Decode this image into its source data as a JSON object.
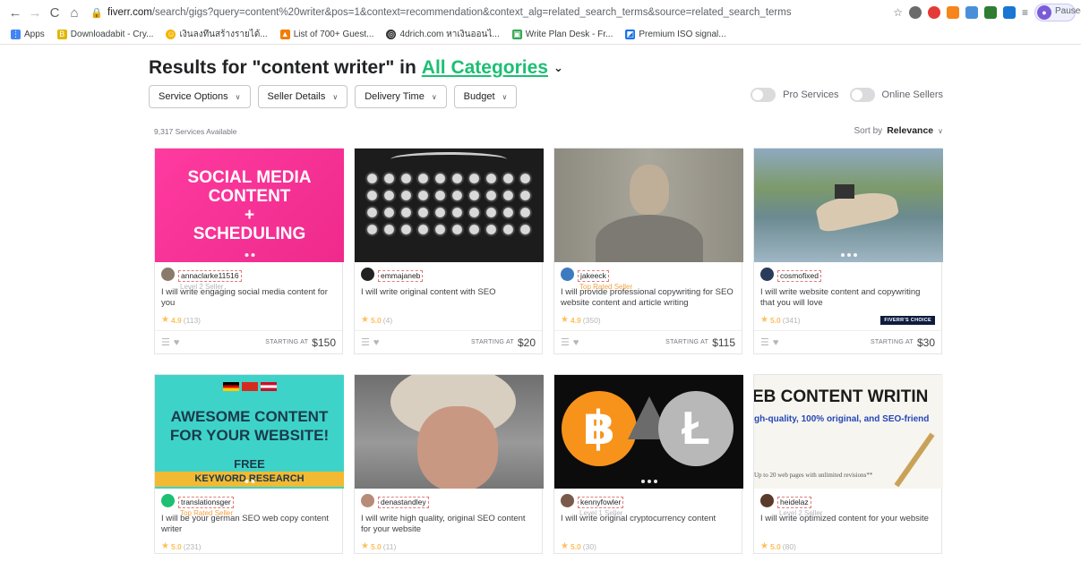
{
  "browser": {
    "url_host": "fiverr.com",
    "url_path": "/search/gigs?query=content%20writer&pos=1&context=recommendation&context_alg=related_search_terms&source=related_search_terms",
    "profile_status": "Paused",
    "bookmarks": [
      {
        "label": "Apps",
        "color": "#4285f4"
      },
      {
        "label": "Downloadabit - Cry...",
        "color": "#e0b700"
      },
      {
        "label": "เงินลงทึนสร้างรายได้...",
        "color": "#f4b400"
      },
      {
        "label": "List of 700+ Guest...",
        "color": "#f57c00"
      },
      {
        "label": "4drich.com หาเงินออนไ...",
        "color": "#333333"
      },
      {
        "label": "Write Plan Desk - Fr...",
        "color": "#34a853"
      },
      {
        "label": "Premium ISO signal...",
        "color": "#1a73e8"
      }
    ]
  },
  "header": {
    "title_prefix": "Results for \"content writer\" in",
    "category": "All Categories"
  },
  "filters": [
    "Service Options",
    "Seller Details",
    "Delivery Time",
    "Budget"
  ],
  "toggles": [
    "Pro Services",
    "Online Sellers"
  ],
  "results_count": "9,317 Services Available",
  "sort": {
    "label": "Sort by",
    "value": "Relevance"
  },
  "cards": [
    {
      "seller": "annaclarke11516",
      "level": "Level 2 Seller",
      "title": "I will write engaging social media content for you",
      "score": "4.9",
      "reviews": "(113)",
      "price": "$150",
      "badge": "",
      "start_label": "STARTING AT",
      "thumb_lines": [
        "SOCIAL MEDIA",
        "CONTENT",
        "+",
        "SCHEDULING"
      ]
    },
    {
      "seller": "emmajaneb",
      "level": "",
      "title": "I will write original content with SEO",
      "score": "5.0",
      "reviews": "(4)",
      "price": "$20",
      "badge": "",
      "start_label": "STARTING AT"
    },
    {
      "seller": "jakeeck",
      "level": "Top Rated Seller",
      "title": "I will provide professional copywriting for SEO website content and article writing",
      "score": "4.9",
      "reviews": "(350)",
      "price": "$115",
      "badge": "",
      "start_label": "STARTING AT"
    },
    {
      "seller": "cosmofixed",
      "level": "",
      "title": "I will write website content and copywriting that you will love",
      "score": "5.0",
      "reviews": "(341)",
      "price": "$30",
      "badge": "FIVERR'S CHOICE",
      "start_label": "STARTING AT"
    },
    {
      "seller": "translationsger",
      "level": "Top Rated Seller",
      "title": "I will be your german SEO web copy content writer",
      "score": "5.0",
      "reviews": "(231)",
      "thumb_lines": [
        "AWESOME CONTENT",
        "FOR YOUR WEBSITE!",
        "FREE",
        "KEYWORD RESEARCH"
      ]
    },
    {
      "seller": "denastandley",
      "level": "",
      "title": "I will write high quality, original SEO content for your website",
      "score": "5.0",
      "reviews": "(11)"
    },
    {
      "seller": "kennyfowler",
      "level": "Level 1 Seller",
      "title": "I will write original cryptocurrency content",
      "score": "5.0",
      "reviews": "(30)"
    },
    {
      "seller": "heidelaz",
      "level": "Level 2 Seller",
      "title": "I will write optimized content for your website",
      "score": "5.0",
      "reviews": "(80)",
      "thumb_lines": [
        "EB CONTENT WRITIN",
        "gh-quality, 100% original, and SEO-friend",
        "Up to 20 web pages with unlimited revisions**"
      ]
    }
  ]
}
